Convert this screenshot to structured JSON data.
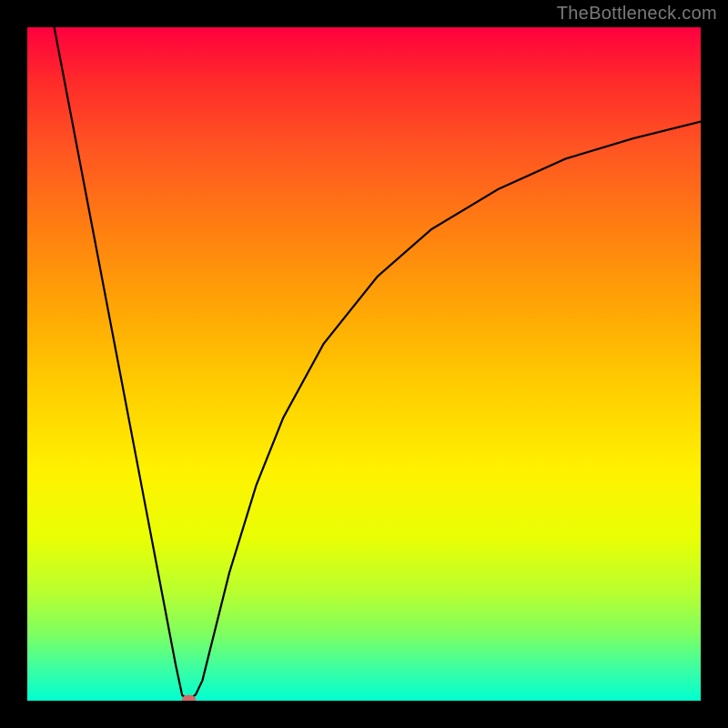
{
  "watermark": "TheBottleneck.com",
  "chart_data": {
    "type": "line",
    "title": "",
    "xlabel": "",
    "ylabel": "",
    "xlim": [
      0,
      100
    ],
    "ylim": [
      0,
      100
    ],
    "grid": false,
    "legend": false,
    "background": {
      "style": "vertical-gradient",
      "top_color": "#ff003f",
      "bottom_color": "#00ffd0"
    },
    "series": [
      {
        "name": "bottleneck-curve",
        "x": [
          4.0,
          6.0,
          8.0,
          10.0,
          12.0,
          14.0,
          16.0,
          18.0,
          20.0,
          22.0,
          23.0,
          24.0,
          25.0,
          26.0,
          28.0,
          30.0,
          34.0,
          38.0,
          44.0,
          52.0,
          60.0,
          70.0,
          80.0,
          90.0,
          100.0
        ],
        "y": [
          100.0,
          89.5,
          79.0,
          68.5,
          58.0,
          47.5,
          37.0,
          26.5,
          16.0,
          5.5,
          0.8,
          0.2,
          0.9,
          3.0,
          11.0,
          19.0,
          32.0,
          42.0,
          53.0,
          63.0,
          70.0,
          76.0,
          80.5,
          83.5,
          86.0
        ]
      }
    ],
    "annotations": [
      {
        "name": "minimum-marker",
        "x": 24.0,
        "y": 0.2,
        "shape": "ellipse",
        "color": "#d46a6a"
      }
    ]
  }
}
